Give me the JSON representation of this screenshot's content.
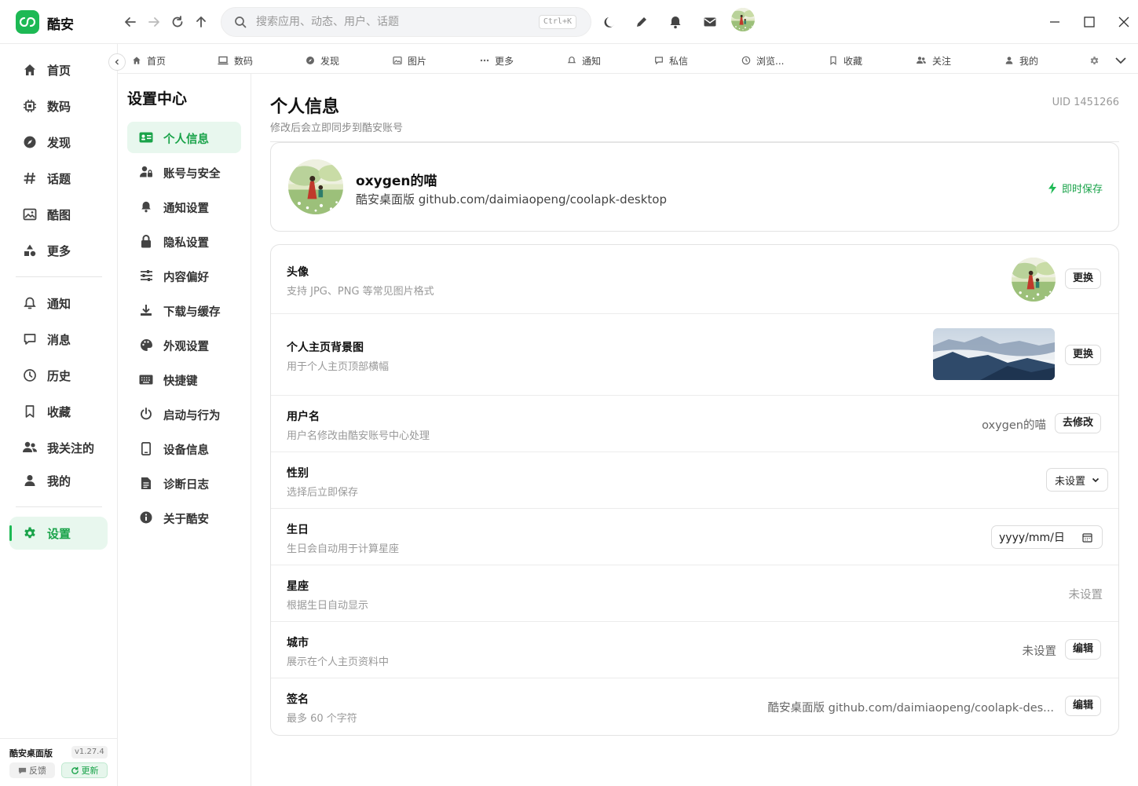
{
  "app": {
    "name": "酷安"
  },
  "search": {
    "placeholder": "搜索应用、动态、用户、话题",
    "shortcut": "Ctrl+K"
  },
  "sidebar": {
    "items": [
      {
        "label": "首页",
        "icon": "home-icon"
      },
      {
        "label": "数码",
        "icon": "chip-icon"
      },
      {
        "label": "发现",
        "icon": "compass-icon"
      },
      {
        "label": "话题",
        "icon": "hash-icon"
      },
      {
        "label": "酷图",
        "icon": "image-icon"
      },
      {
        "label": "更多",
        "icon": "shapes-icon"
      },
      {
        "label": "通知",
        "icon": "bell-icon"
      },
      {
        "label": "消息",
        "icon": "message-icon"
      },
      {
        "label": "历史",
        "icon": "clock-icon"
      },
      {
        "label": "收藏",
        "icon": "bookmark-icon"
      },
      {
        "label": "我关注的",
        "icon": "users-icon"
      },
      {
        "label": "我的",
        "icon": "user-icon"
      },
      {
        "label": "设置",
        "icon": "gear-icon"
      }
    ],
    "footer": {
      "name": "酷安桌面版",
      "version": "v1.27.4",
      "feedback": "反馈",
      "update": "更新"
    }
  },
  "tabs": [
    "首页",
    "数码",
    "发现",
    "图片",
    "更多",
    "通知",
    "私信",
    "浏览...",
    "收藏",
    "关注",
    "我的"
  ],
  "settings_nav": {
    "title": "设置中心",
    "items": [
      "个人信息",
      "账号与安全",
      "通知设置",
      "隐私设置",
      "内容偏好",
      "下载与缓存",
      "外观设置",
      "快捷键",
      "启动与行为",
      "设备信息",
      "诊断日志",
      "关于酷安"
    ]
  },
  "page": {
    "title": "个人信息",
    "subtitle": "修改后会立即同步到酷安账号",
    "uid": "UID 1451266"
  },
  "profile": {
    "name": "oxygen的喵",
    "signature": "酷安桌面版 github.com/daimiaopeng/coolapk-desktop",
    "instant_save": "即时保存"
  },
  "rows": {
    "avatar": {
      "title": "头像",
      "sub": "支持 JPG、PNG 等常见图片格式",
      "button": "更换"
    },
    "cover": {
      "title": "个人主页背景图",
      "sub": "用于个人主页顶部横幅",
      "button": "更换"
    },
    "username": {
      "title": "用户名",
      "sub": "用户名修改由酷安账号中心处理",
      "value": "oxygen的喵",
      "button": "去修改"
    },
    "gender": {
      "title": "性别",
      "sub": "选择后立即保存",
      "value": "未设置"
    },
    "birthday": {
      "title": "生日",
      "sub": "生日会自动用于计算星座",
      "value": "yyyy/mm/日"
    },
    "zodiac": {
      "title": "星座",
      "sub": "根据生日自动显示",
      "value": "未设置"
    },
    "city": {
      "title": "城市",
      "sub": "展示在个人主页资料中",
      "value": "未设置",
      "button": "编辑"
    },
    "signature": {
      "title": "签名",
      "sub": "最多 60 个字符",
      "value": "酷安桌面版 github.com/daimiaopeng/coolapk-des...",
      "button": "编辑"
    }
  },
  "colors": {
    "accent": "#1db954",
    "accent_text": "#1aa34a",
    "active_bg": "#e8f7ee"
  }
}
